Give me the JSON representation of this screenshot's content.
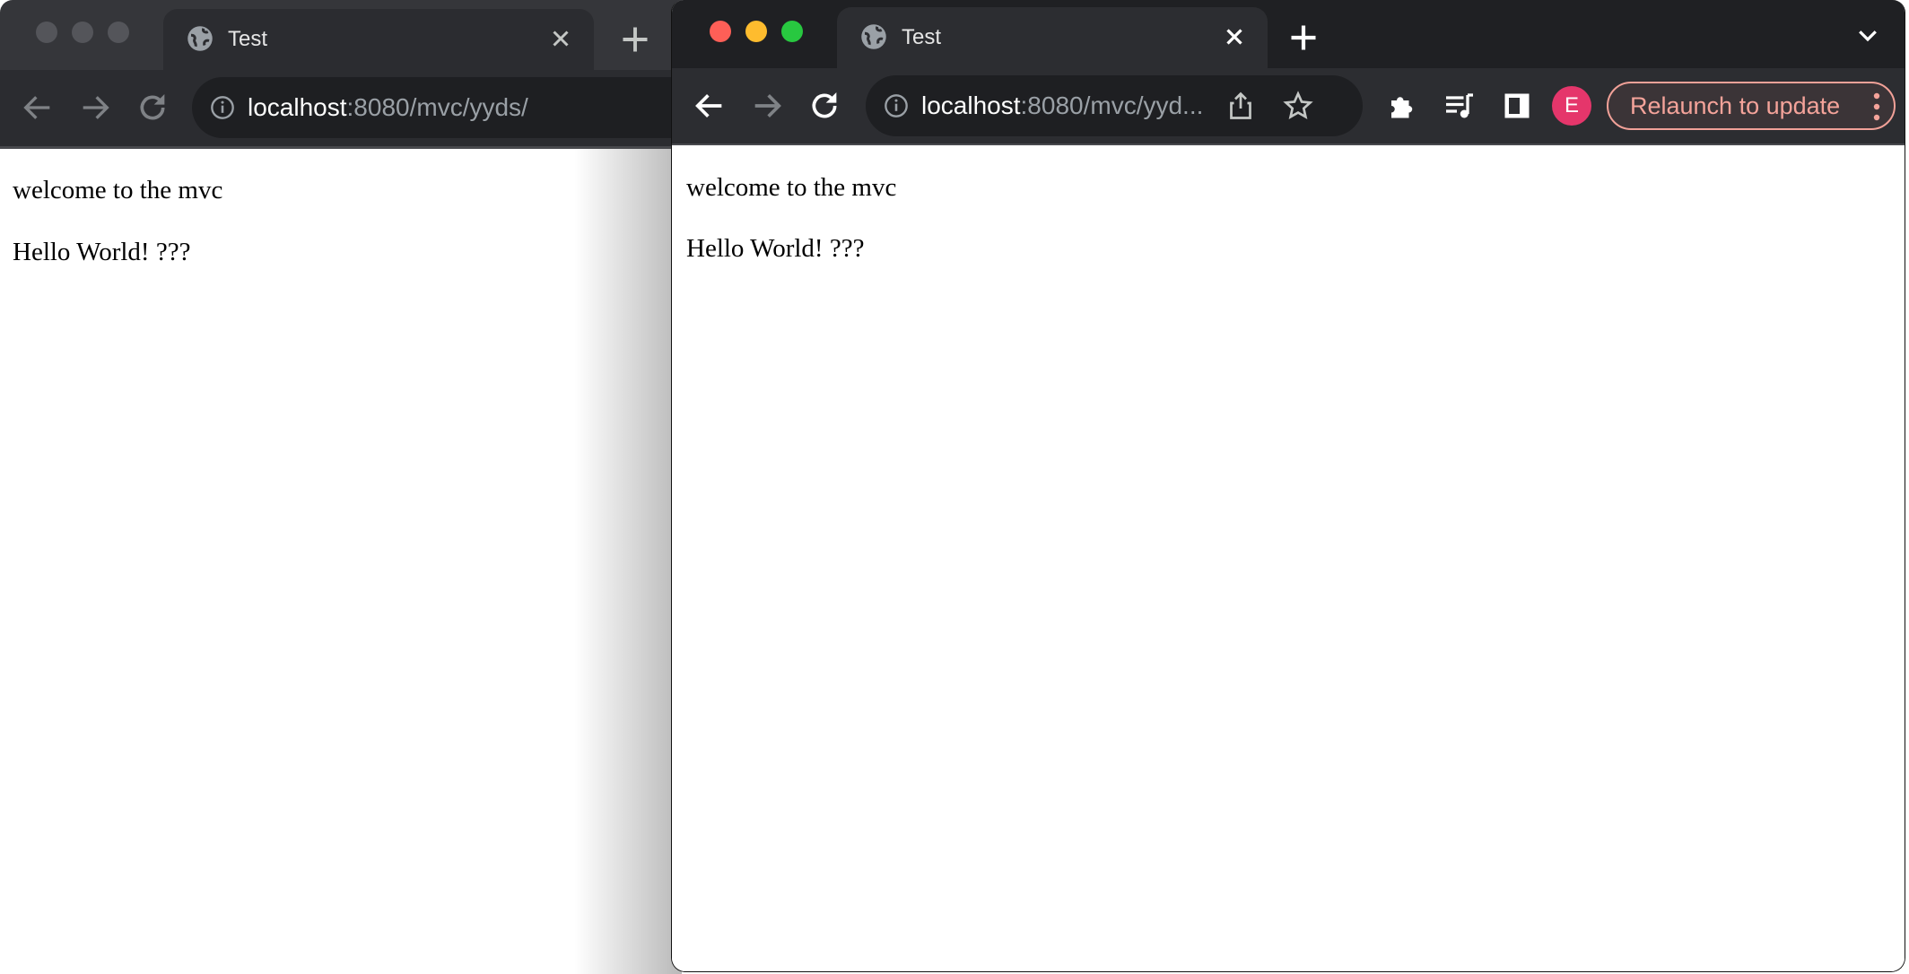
{
  "left_window": {
    "state": "inactive",
    "tab": {
      "title": "Test",
      "favicon": "globe-icon",
      "close_icon": "close-icon"
    },
    "new_tab_icon": "plus-icon",
    "toolbar": {
      "back_icon": "arrow-left-icon",
      "forward_icon": "arrow-right-icon",
      "reload_icon": "reload-icon",
      "site_info_icon": "info-icon",
      "url_host": "localhost",
      "url_rest": ":8080/mvc/yyds/"
    },
    "page": {
      "line1": "welcome to the mvc",
      "line2": "Hello World! ???"
    }
  },
  "right_window": {
    "state": "active",
    "traffic_lights": {
      "close": "#fe5f57",
      "minimize": "#febc2e",
      "zoom": "#28c840"
    },
    "tab": {
      "title": "Test",
      "favicon": "globe-icon",
      "close_icon": "close-icon"
    },
    "new_tab_icon": "plus-icon",
    "tab_search_icon": "chevron-down-icon",
    "toolbar": {
      "back_icon": "arrow-left-icon",
      "forward_icon": "arrow-right-icon",
      "reload_icon": "reload-icon",
      "site_info_icon": "info-icon",
      "url_host": "localhost",
      "url_rest": ":8080/mvc/yyd...",
      "share_icon": "share-icon",
      "bookmark_icon": "star-icon",
      "extensions_icon": "puzzle-icon",
      "media_icon": "playlist-music-icon",
      "side_panel_icon": "side-panel-icon",
      "profile_initial": "E",
      "profile_color": "#e5366b",
      "relaunch_label": "Relaunch to update",
      "relaunch_color": "#f4a39a",
      "menu_icon": "kebab-menu-icon"
    },
    "page": {
      "line1": "welcome to the mvc",
      "line2": "Hello World! ???"
    }
  }
}
